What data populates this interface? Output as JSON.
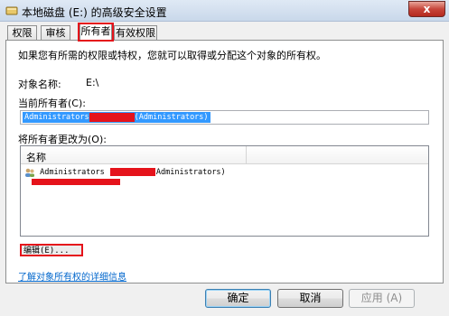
{
  "window": {
    "title": "本地磁盘 (E:) 的高级安全设置",
    "close_glyph": "x"
  },
  "tabs": [
    {
      "label": "权限"
    },
    {
      "label": "审核"
    },
    {
      "label": "所有者",
      "active": true
    },
    {
      "label": "有效权限"
    }
  ],
  "owner_page": {
    "description": "如果您有所需的权限或特权，您就可以取得或分配这个对象的所有权。",
    "object_name_label": "对象名称:",
    "object_name_value": "E:\\",
    "current_owner_label": "当前所有者(C):",
    "current_owner_value_prefix": "Administrators",
    "current_owner_value_suffix": "(Administrators)",
    "change_owner_label": "将所有者更改为(O):",
    "list_header_name": "名称",
    "list_items": [
      {
        "prefix": "Administrators",
        "suffix": "Administrators)"
      }
    ],
    "edit_button": "编辑(E)...",
    "details_link": "了解对象所有权的详细信息"
  },
  "buttons": {
    "ok": "确定",
    "cancel": "取消",
    "apply": "应用 (A)"
  },
  "colors": {
    "highlight_red": "#e5131b",
    "selection_blue": "#3399ff",
    "link_blue": "#0066cc"
  }
}
